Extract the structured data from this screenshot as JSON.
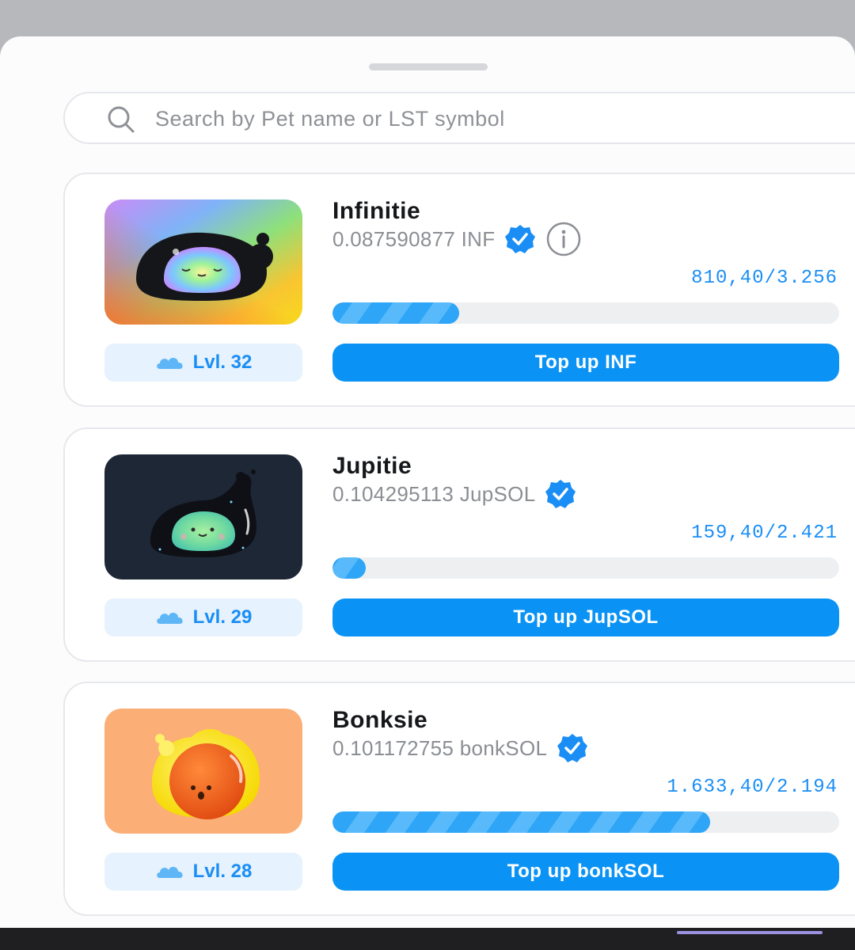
{
  "search": {
    "placeholder": "Search by Pet name or LST symbol",
    "icon": "search-icon"
  },
  "colors": {
    "accent": "#0a93f5",
    "accent_text": "#1a8ef5",
    "level_bg": "#e6f2fd",
    "card_border": "#e6e8ec"
  },
  "pets": [
    {
      "name": "Infinitie",
      "balance": "0.087590877 INF",
      "verified": true,
      "has_info": true,
      "progress_text": "810,40/3.256",
      "progress_fraction": 0.25,
      "level": "Lvl. 32",
      "button_label": "Top up INF",
      "art": "rainbow-blob-pet"
    },
    {
      "name": "Jupitie",
      "balance": "0.104295113 JupSOL",
      "verified": true,
      "has_info": false,
      "progress_text": "159,40/2.421",
      "progress_fraction": 0.066,
      "level": "Lvl. 29",
      "button_label": "Top up JupSOL",
      "art": "green-blob-pet"
    },
    {
      "name": "Bonksie",
      "balance": "0.101172755 bonkSOL",
      "verified": true,
      "has_info": false,
      "progress_text": "1.633,40/2.194",
      "progress_fraction": 0.745,
      "level": "Lvl. 28",
      "button_label": "Top up bonkSOL",
      "art": "orange-blob-pet"
    }
  ]
}
